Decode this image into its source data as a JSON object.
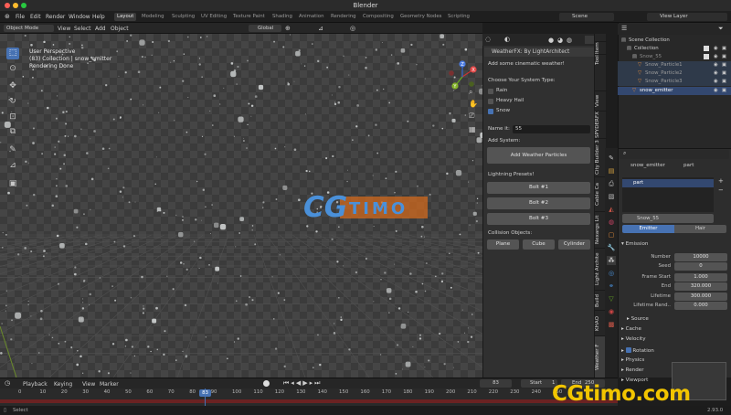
{
  "window": {
    "title": "Blender"
  },
  "menu": [
    "File",
    "Edit",
    "Render",
    "Window",
    "Help"
  ],
  "workspaces": [
    "Layout",
    "Modeling",
    "Sculpting",
    "UV Editing",
    "Texture Paint",
    "Shading",
    "Animation",
    "Rendering",
    "Compositing",
    "Geometry Nodes",
    "Scripting"
  ],
  "active_workspace": "Layout",
  "scene": {
    "name": "Scene",
    "view_layer": "View Layer"
  },
  "viewport_header": {
    "mode": "Object Mode",
    "menus": [
      "View",
      "Select",
      "Add",
      "Object"
    ],
    "transform": "Global",
    "options": "Options"
  },
  "viewport_overlay": {
    "line1": "User Perspective",
    "line2": "(83) Collection | snow_emitter",
    "line3": "Rendering Done"
  },
  "gizmo": {
    "x": "X",
    "y": "Y",
    "z": "Z"
  },
  "npanel": {
    "title": "WeatherFX: By LightArchitect",
    "intro": "Add some cinematic weather!",
    "choose_label": "Choose Your System Type:",
    "types": [
      {
        "label": "Rain",
        "checked": false
      },
      {
        "label": "Heavy Hail",
        "checked": false
      },
      {
        "label": "Snow",
        "checked": true
      }
    ],
    "name_label": "Name it:",
    "name_value": "55",
    "add_system_label": "Add System:",
    "add_button": "Add Weather Particles",
    "lightning_label": "Lightning Presets!",
    "bolts": [
      "Bolt #1",
      "Bolt #2",
      "Bolt #3"
    ],
    "collision_label": "Collision Objects:",
    "collisions": [
      "Plane",
      "Cube",
      "Cylinder"
    ]
  },
  "vertical_tabs": [
    "Item",
    "Tool",
    "View",
    "SPYDERFX",
    "City Builder 3",
    "Cable Ca",
    "Nexargs Lit",
    "Light Archite",
    "Build",
    "KHAO",
    "Weather F"
  ],
  "outliner": {
    "rows": [
      {
        "label": "Scene Collection",
        "indent": 0
      },
      {
        "label": "Collection",
        "indent": 1
      },
      {
        "label": "Snow_55",
        "indent": 2
      },
      {
        "label": "Snow_Particle1",
        "indent": 3
      },
      {
        "label": "Snow_Particle2",
        "indent": 3
      },
      {
        "label": "Snow_Particle3",
        "indent": 3
      },
      {
        "label": "snow_emitter",
        "indent": 2
      }
    ]
  },
  "properties": {
    "object": "snow_emitter",
    "particle_tab": "part",
    "slot": "part",
    "system_name": "Snow_55",
    "mode_tabs": [
      "Emitter",
      "Hair"
    ],
    "active_mode": "Emitter",
    "emission_title": "Emission",
    "fields": [
      {
        "label": "Number",
        "value": "10000"
      },
      {
        "label": "Seed",
        "value": "0"
      },
      {
        "label": "Frame Start",
        "value": "1.000"
      },
      {
        "label": "End",
        "value": "320.000"
      },
      {
        "label": "Lifetime",
        "value": "300.000"
      },
      {
        "label": "Lifetime Rand..",
        "value": "0.000"
      }
    ],
    "subsection": "Source",
    "panels": [
      "Cache",
      "Velocity",
      "Rotation",
      "Physics",
      "Render",
      "Viewport"
    ]
  },
  "timeline": {
    "menus": [
      "Playback",
      "Keying",
      "View",
      "Marker"
    ],
    "current_frame": "83",
    "start_label": "Start",
    "start": "1",
    "end_label": "End",
    "end": "250",
    "ticks": [
      "0",
      "10",
      "20",
      "30",
      "40",
      "50",
      "60",
      "70",
      "80",
      "90",
      "100",
      "110",
      "120",
      "130",
      "140",
      "150",
      "160",
      "170",
      "180",
      "190",
      "200",
      "210",
      "220",
      "230",
      "240",
      "250"
    ]
  },
  "status": {
    "left": "Select",
    "right": "2.93.0"
  },
  "watermarks": {
    "center": "CGTIMO",
    "bottom": "CGtimo.com"
  },
  "colors": {
    "accent": "#4772b3",
    "logo_orange": "#d26a1e",
    "logo_blue": "#4a90d9",
    "watermark_yellow": "#f2c500"
  }
}
